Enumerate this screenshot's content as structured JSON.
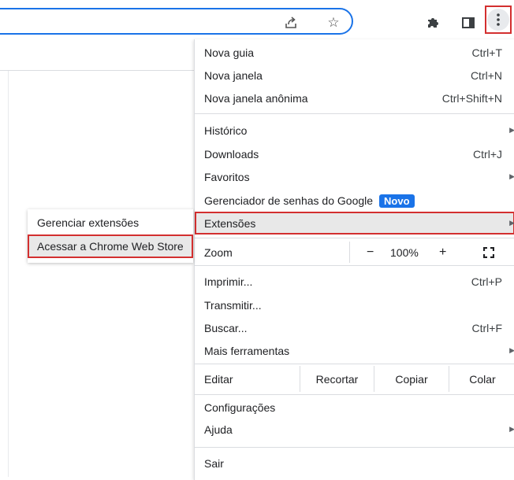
{
  "toolbar": {
    "icons": [
      "share-icon",
      "star-icon",
      "extensions-puzzle-icon",
      "side-panel-icon",
      "more-vert-icon"
    ]
  },
  "menu": {
    "items": [
      {
        "label": "Nova guia",
        "shortcut": "Ctrl+T"
      },
      {
        "label": "Nova janela",
        "shortcut": "Ctrl+N"
      },
      {
        "label": "Nova janela anônima",
        "shortcut": "Ctrl+Shift+N"
      },
      {
        "label": "Histórico"
      },
      {
        "label": "Downloads",
        "shortcut": "Ctrl+J"
      },
      {
        "label": "Favoritos"
      },
      {
        "label": "Gerenciador de senhas do Google",
        "badge": "Novo"
      },
      {
        "label": "Extensões"
      },
      {
        "label": "Imprimir...",
        "shortcut": "Ctrl+P"
      },
      {
        "label": "Transmitir..."
      },
      {
        "label": "Buscar...",
        "shortcut": "Ctrl+F"
      },
      {
        "label": "Mais ferramentas"
      },
      {
        "label": "Configurações"
      },
      {
        "label": "Ajuda"
      },
      {
        "label": "Sair"
      }
    ],
    "zoom": {
      "label": "Zoom",
      "minus": "−",
      "value": "100%",
      "plus": "+"
    },
    "edit": {
      "label": "Editar",
      "cut": "Recortar",
      "copy": "Copiar",
      "paste": "Colar"
    }
  },
  "submenu": {
    "items": [
      "Gerenciar extensões",
      "Acessar a Chrome Web Store"
    ]
  },
  "colors": {
    "highlight_border": "#d32f2f",
    "badge_bg": "#1a73e8",
    "hover_bg": "#e8e8e8"
  }
}
